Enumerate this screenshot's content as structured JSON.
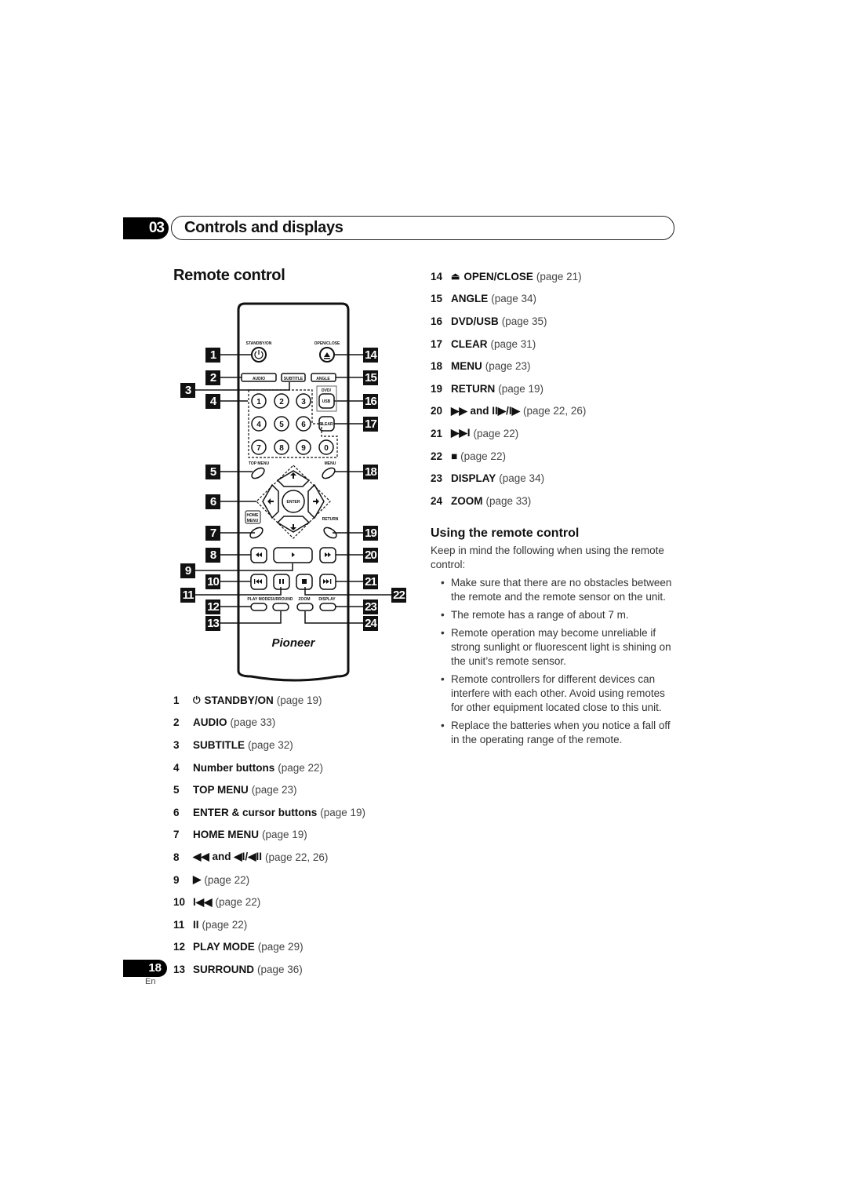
{
  "chapter": {
    "number": "03",
    "title": "Controls and displays"
  },
  "section": {
    "title": "Remote control"
  },
  "remote": {
    "brand": "Pioneer",
    "button_labels": {
      "standby": "STANDBY/ON",
      "open_close": "OPEN/CLOSE",
      "audio": "AUDIO",
      "subtitle": "SUBTITLE",
      "angle": "ANGLE",
      "dvd_usb_top": "DVD/",
      "usb": "USB",
      "clear": "CLEAR",
      "top_menu": "TOP MENU",
      "menu": "MENU",
      "enter": "ENTER",
      "home_menu_1": "HOME",
      "home_menu_2": "MENU",
      "return": "RETURN",
      "play_mode": "PLAY MODE",
      "surround": "SURROUND",
      "zoom": "ZOOM",
      "display": "DISPLAY",
      "numbers": [
        "1",
        "2",
        "3",
        "4",
        "5",
        "6",
        "7",
        "8",
        "9",
        "0"
      ]
    },
    "callouts": [
      "1",
      "2",
      "3",
      "4",
      "5",
      "6",
      "7",
      "8",
      "9",
      "10",
      "11",
      "12",
      "13",
      "14",
      "15",
      "16",
      "17",
      "18",
      "19",
      "20",
      "21",
      "22",
      "23",
      "24"
    ]
  },
  "left_list": [
    {
      "num": "1",
      "symbol": "⏻",
      "label": "STANDBY/ON",
      "page": "(page 19)"
    },
    {
      "num": "2",
      "symbol": "",
      "label": "AUDIO",
      "page": "(page 33)"
    },
    {
      "num": "3",
      "symbol": "",
      "label": "SUBTITLE",
      "page": "(page 32)"
    },
    {
      "num": "4",
      "symbol": "",
      "label": "Number buttons",
      "page": "(page 22)"
    },
    {
      "num": "5",
      "symbol": "",
      "label": "TOP MENU",
      "page": "(page 23)"
    },
    {
      "num": "6",
      "symbol": "",
      "label": "ENTER & cursor buttons",
      "page": "(page 19)"
    },
    {
      "num": "7",
      "symbol": "",
      "label": "HOME MENU",
      "page": "(page 19)"
    },
    {
      "num": "8",
      "symbol": "",
      "label": "◀◀ and ◀I/◀II",
      "page": "(page 22, 26)"
    },
    {
      "num": "9",
      "symbol": "",
      "label": "▶",
      "page": "(page 22)"
    },
    {
      "num": "10",
      "symbol": "",
      "label": "I◀◀",
      "page": "(page 22)"
    },
    {
      "num": "11",
      "symbol": "",
      "label": "II",
      "page": "(page 22)"
    },
    {
      "num": "12",
      "symbol": "",
      "label": "PLAY MODE",
      "page": "(page 29)"
    },
    {
      "num": "13",
      "symbol": "",
      "label": "SURROUND",
      "page": "(page 36)"
    }
  ],
  "right_list": [
    {
      "num": "14",
      "symbol": "⏏",
      "label": "OPEN/CLOSE",
      "page": "(page 21)"
    },
    {
      "num": "15",
      "symbol": "",
      "label": "ANGLE",
      "page": "(page 34)"
    },
    {
      "num": "16",
      "symbol": "",
      "label": "DVD/USB",
      "page": "(page 35)"
    },
    {
      "num": "17",
      "symbol": "",
      "label": "CLEAR",
      "page": "(page 31)"
    },
    {
      "num": "18",
      "symbol": "",
      "label": "MENU",
      "page": "(page 23)"
    },
    {
      "num": "19",
      "symbol": "",
      "label": "RETURN",
      "page": "(page 19)"
    },
    {
      "num": "20",
      "symbol": "",
      "label": "▶▶ and II▶/I▶",
      "page": "(page 22, 26)"
    },
    {
      "num": "21",
      "symbol": "",
      "label": "▶▶I",
      "page": "(page 22)"
    },
    {
      "num": "22",
      "symbol": "",
      "label": "■",
      "page": "(page 22)"
    },
    {
      "num": "23",
      "symbol": "",
      "label": "DISPLAY",
      "page": "(page 34)"
    },
    {
      "num": "24",
      "symbol": "",
      "label": "ZOOM",
      "page": "(page 33)"
    }
  ],
  "usage": {
    "title": "Using the remote control",
    "intro": "Keep in mind the following when using the remote control:",
    "bullets": [
      "Make sure that there are no obstacles between the remote and the remote sensor on the unit.",
      "The remote has a range of about 7 m.",
      "Remote operation may become unreliable if strong sunlight or fluorescent light is shining on the unit’s remote sensor.",
      "Remote controllers for different devices can interfere with each other. Avoid using remotes for other equipment located close to this unit.",
      "Replace the batteries when you notice a fall off in the operating range of the remote."
    ]
  },
  "footer": {
    "page_number": "18",
    "language": "En"
  }
}
